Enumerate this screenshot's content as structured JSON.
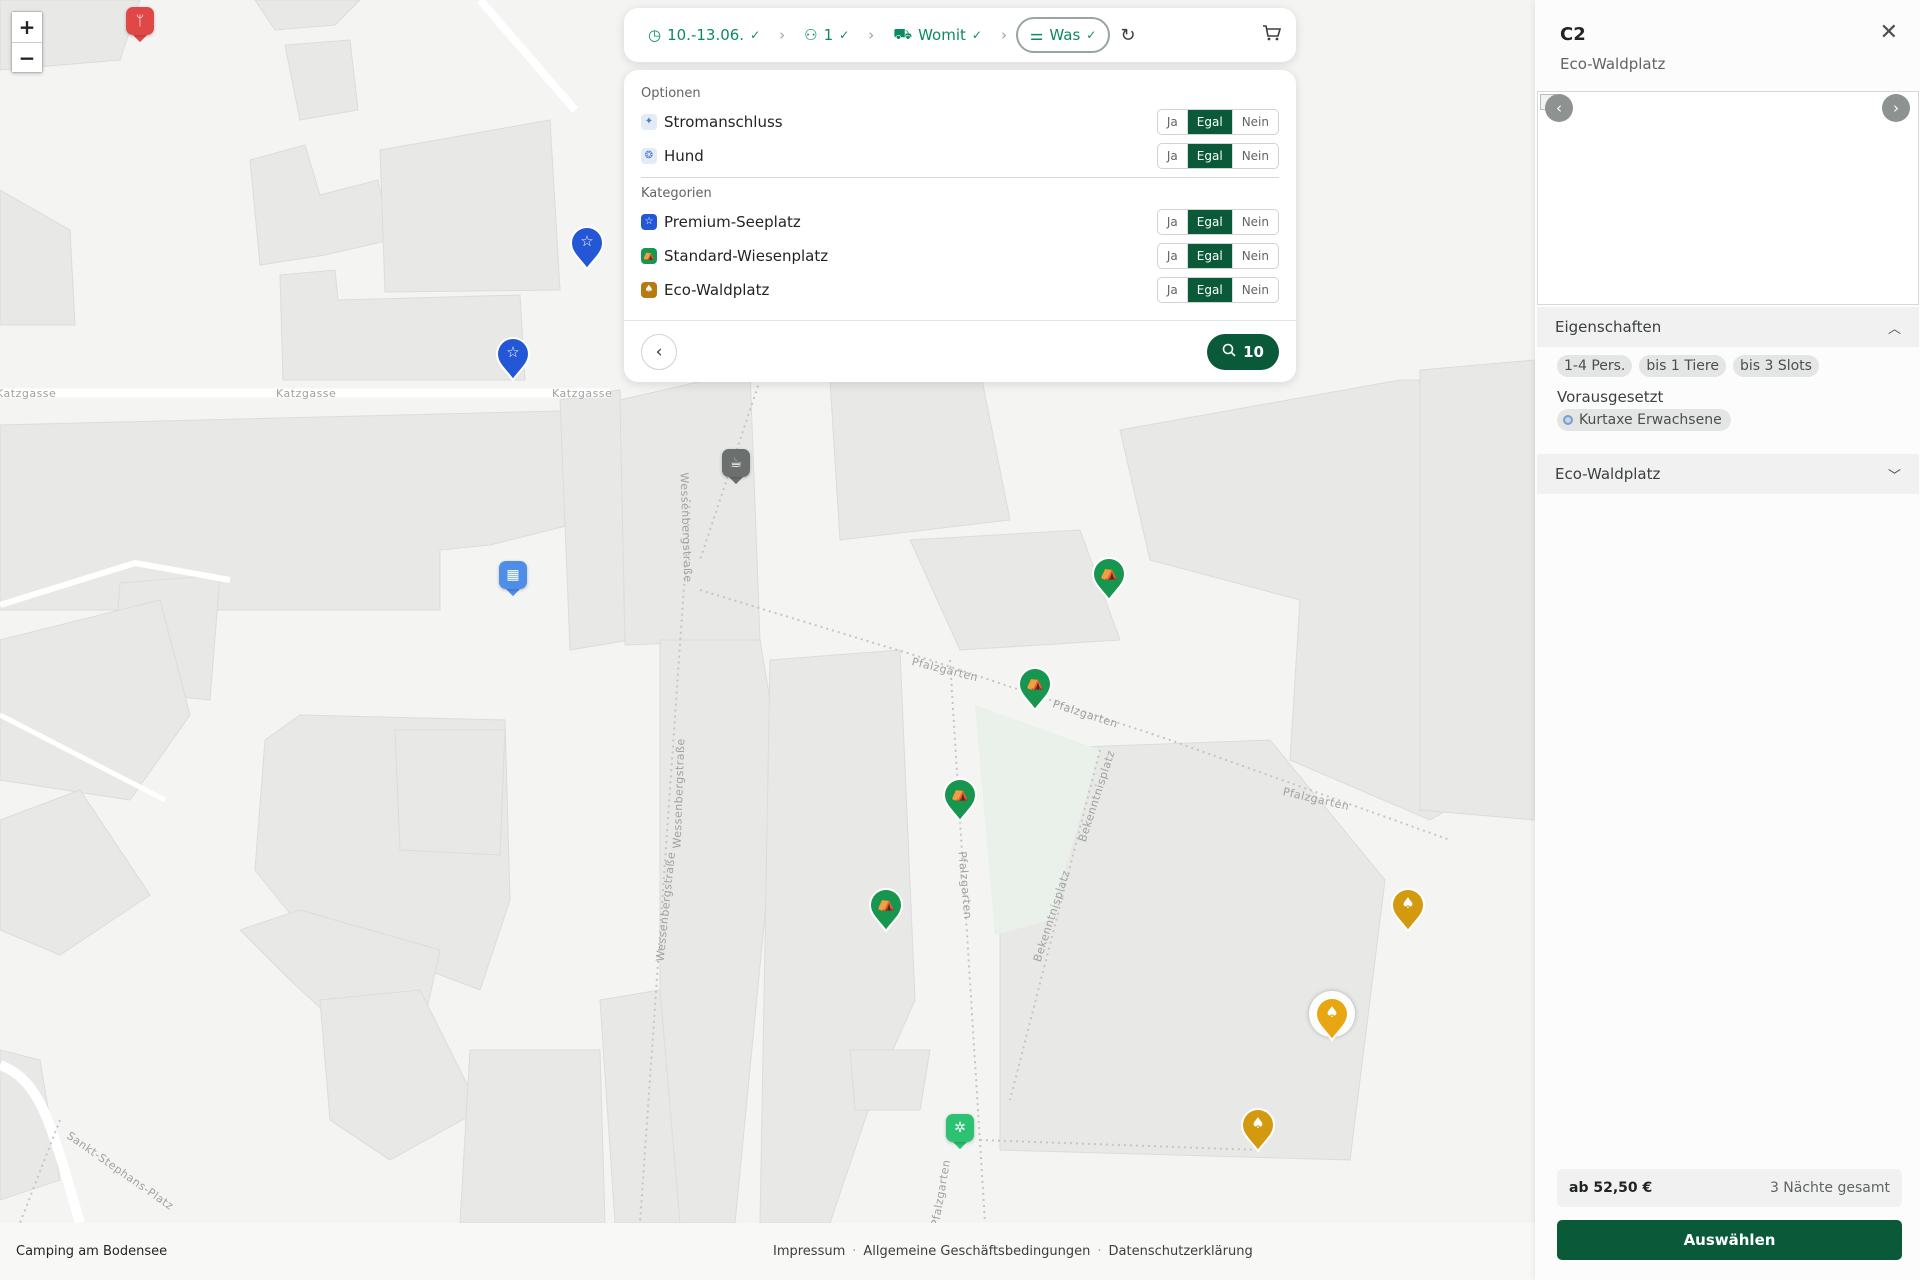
{
  "map": {
    "zoom_in": "+",
    "zoom_out": "−",
    "streets": {
      "katzgasse": "Katzgasse",
      "wessenbergstrasse": "Wessenbergstraße",
      "pfalzgarten": "Pfalzgarten",
      "bekenntnisplatz": "Bekenntnisplatz",
      "sankt_stephans_platz": "Sankt-Stephans-Platz"
    },
    "colors": {
      "premium": "#2457d6",
      "standard": "#17964f",
      "eco": "#d39a0f",
      "restaurant": "#e04848",
      "cafe": "#6b6f6d",
      "building": "#4f8ee8",
      "playground": "#2cc271"
    }
  },
  "topbar": {
    "steps": [
      {
        "label": "10.-13.06.",
        "icon": "clock-icon"
      },
      {
        "label": "1",
        "icon": "users-icon"
      },
      {
        "label": "Womit",
        "icon": "camper-icon"
      },
      {
        "label": "Was",
        "icon": "sliders-icon"
      }
    ],
    "check": "✓",
    "separator": "›",
    "reset_icon": "↻"
  },
  "filter": {
    "options_title": "Optionen",
    "categories_title": "Kategorien",
    "seg": {
      "yes": "Ja",
      "any": "Egal",
      "no": "Nein"
    },
    "options": [
      {
        "label": "Stromanschluss",
        "icon": "power-icon",
        "glyph": "✦"
      },
      {
        "label": "Hund",
        "icon": "dog-icon",
        "glyph": "❂"
      }
    ],
    "categories": [
      {
        "label": "Premium-Seeplatz",
        "icon": "star-icon",
        "glyph": "☆",
        "color": "#2457d6"
      },
      {
        "label": "Standard-Wiesenplatz",
        "icon": "tent-icon",
        "glyph": "⛺",
        "color": "#17964f"
      },
      {
        "label": "Eco-Waldplatz",
        "icon": "tree-icon",
        "glyph": "♠",
        "color": "#b67a0e"
      }
    ],
    "selected": "Egal",
    "results": "10"
  },
  "footer": {
    "brand": "Camping am Bodensee",
    "links": [
      "Impressum",
      "Allgemeine Geschäftsbedingungen",
      "Datenschutzerklärung"
    ]
  },
  "drawer": {
    "title": "C2",
    "subtitle": "Eco-Waldplatz",
    "close": "✕",
    "properties_title": "Eigenschaften",
    "chips": [
      "1-4 Pers.",
      "bis 1 Tiere",
      "bis 3 Slots"
    ],
    "required_title": "Vorausgesetzt",
    "required_item": "Kurtaxe Erwachsene",
    "section2_title": "Eco-Waldplatz",
    "price": "ab 52,50 €",
    "nights": "3 Nächte gesamt",
    "select": "Auswählen"
  }
}
